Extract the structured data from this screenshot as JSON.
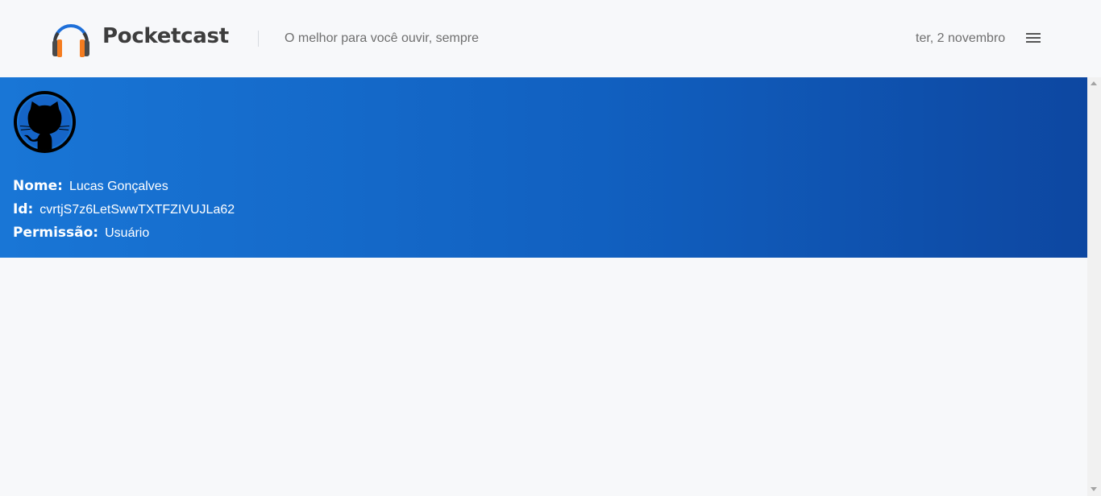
{
  "header": {
    "brand": "Pocketcast",
    "tagline": "O melhor para você ouvir, sempre",
    "date": "ter, 2 novembro",
    "logo_icon": "headphones-icon",
    "menu_icon": "hamburger-menu-icon"
  },
  "profile": {
    "avatar_icon": "github-octocat-icon",
    "name_label": "Nome:",
    "name_value": "Lucas Gonçalves",
    "id_label": "Id:",
    "id_value": "cvrtjS7z6LetSwwTXTFZIVUJLa62",
    "permission_label": "Permissão:",
    "permission_value": "Usuário"
  },
  "colors": {
    "banner_start": "#1976d6",
    "banner_end": "#0d47a1",
    "headphone_blue": "#1e6fd9",
    "headphone_orange": "#f57c1f"
  }
}
